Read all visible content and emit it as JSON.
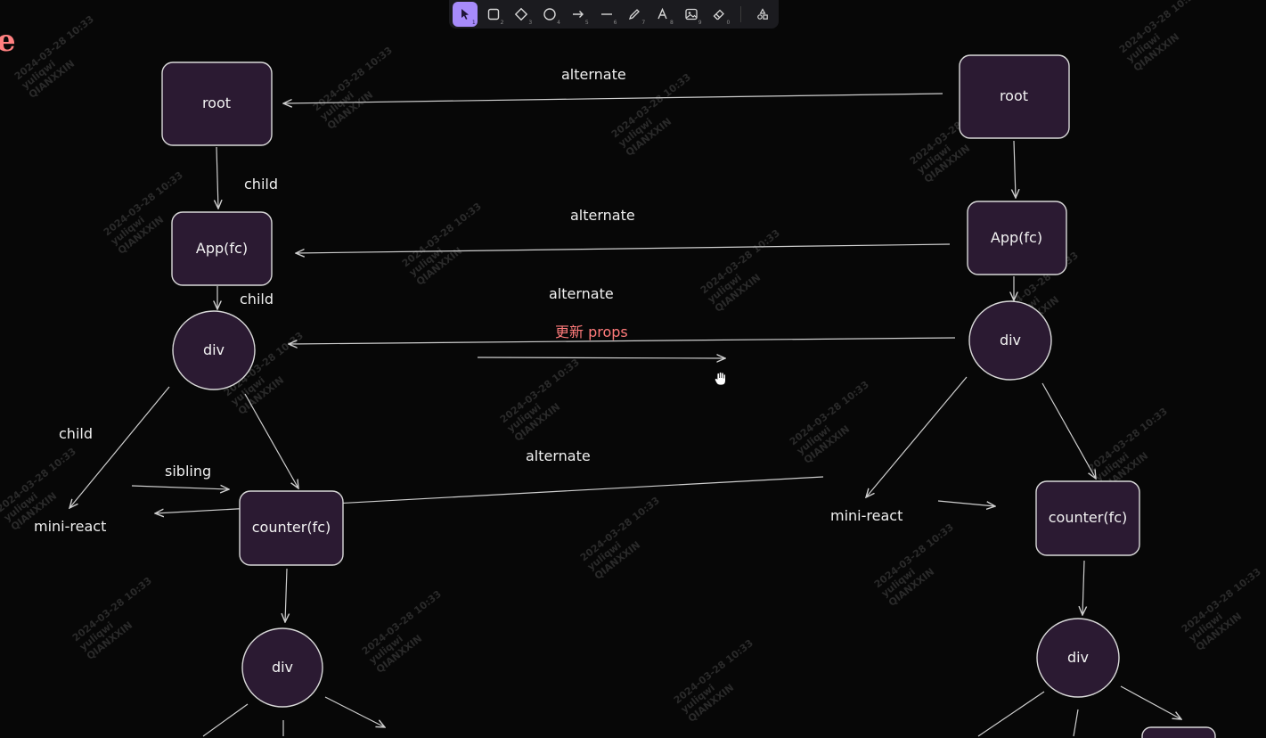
{
  "toolbar": {
    "tools": [
      {
        "name": "selection",
        "key": "1",
        "active": true
      },
      {
        "name": "rectangle",
        "key": "2"
      },
      {
        "name": "diamond",
        "key": "3"
      },
      {
        "name": "ellipse",
        "key": "4"
      },
      {
        "name": "arrow",
        "key": "5"
      },
      {
        "name": "line",
        "key": "6"
      },
      {
        "name": "draw",
        "key": "7"
      },
      {
        "name": "text",
        "key": "8"
      },
      {
        "name": "image",
        "key": "9"
      },
      {
        "name": "eraser",
        "key": "0"
      },
      {
        "name": "more",
        "key": ""
      }
    ]
  },
  "canvas": {
    "corner_glyph": "e",
    "watermark": [
      "2024-03-28 10:33",
      "yuliqwi",
      "QIANXXIN"
    ],
    "colors": {
      "node_fill": "#2b1a32",
      "node_stroke": "#d9d9d9",
      "edge_stroke": "#cfcfcf",
      "accent_red": "#ff7b7b",
      "toolbar_active": "#a78bfa"
    },
    "nodes": [
      {
        "id": "l_root",
        "label": "root"
      },
      {
        "id": "l_app",
        "label": "App(fc)"
      },
      {
        "id": "l_div",
        "label": "div"
      },
      {
        "id": "l_counter",
        "label": "counter(fc)"
      },
      {
        "id": "l_div2",
        "label": "div"
      },
      {
        "id": "r_root",
        "label": "root"
      },
      {
        "id": "r_app",
        "label": "App(fc)"
      },
      {
        "id": "r_div",
        "label": "div"
      },
      {
        "id": "r_counter",
        "label": "counter(fc)"
      },
      {
        "id": "r_div2",
        "label": "div"
      }
    ],
    "labels": {
      "l_mini_react": "mini-react",
      "r_mini_react": "mini-react",
      "child_1": "child",
      "child_2": "child",
      "child_3": "child",
      "sibling": "sibling",
      "alt_1": "alternate",
      "alt_2": "alternate",
      "alt_3": "alternate",
      "alt_4": "alternate",
      "update_props": "更新 props"
    }
  }
}
